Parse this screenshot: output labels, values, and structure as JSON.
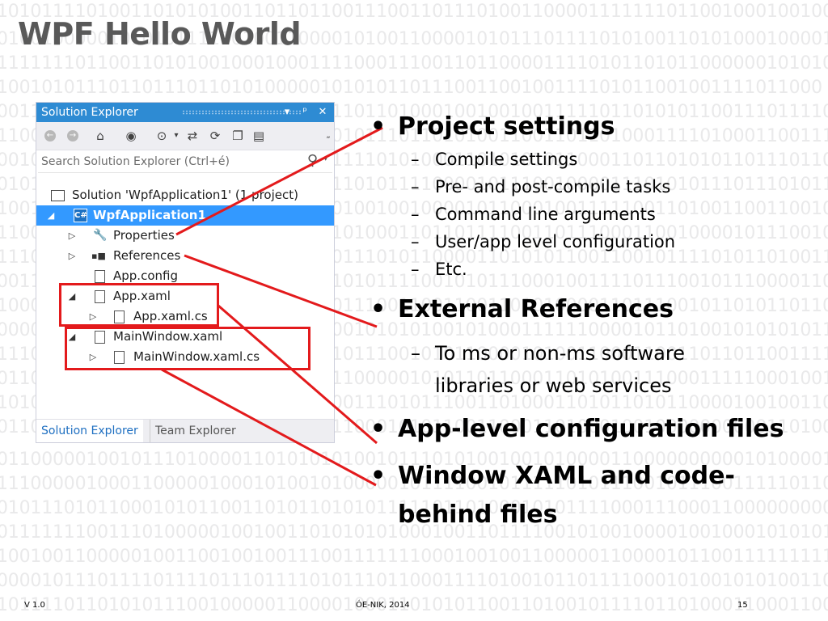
{
  "slide": {
    "title": "WPF Hello World",
    "background_digits_color": "#e9e9ea",
    "binary_rows": [
      "10101111010011010101001101101100111001101110100110000111111101100100010010001",
      "01001000001010101111101001100001010011000010101110111101010011010100010000100000010",
      "11111110110011010100100010001111000111001101100001111010110101100000010101010",
      "10010101110110111011010100000101010110111001100100111101011001001111011000",
      "00110010111011101110010010011011011010001001001001111101101010110011101111010",
      "11001010101100011011001101110001011101101010011001101101000111101000110011111",
      "00100010000111101101010101110111110101000110101010110001101101010110111011010",
      "01011001100001011101000110000111010111100001011100100001110101011101110101110",
      "10010011001110111110000000101001001001000010110001001111100110100110011001000",
      "11000001001101001011100111001110100011011011110011011100011001000010111001001",
      "11100110000110001111100101110001110101100001101010110011001011110101101001101",
      "00110000110010111001001110101010101111001010111000100111101110010111000011011",
      "10000100101100101110011100011101110011001100110101000011011100101101011011010",
      "00000000100101111100101101001100101010100101000111111000010110100101010101100",
      "11101011010110011101001110000110111001010110000101001100011001101101100111101",
      "01100101110101100000100001101011000001010110110001101010011100011111000100110",
      "10101110010101000011010001111000111010111001101000110101101011000010010011011",
      "01100001100011000101010101000011000101011001100011010001001000000000011010001111",
      "01100000100101110100001101010101001011101010010010100001100000000001010000101011",
      "11100000100011000001000101001010000010111100101111101011100101110011111011001",
      "01011101011000101011001101011010101111101101000101011110001110001100000000000",
      "01111111001110100000100100110101010100010011011110010100100001001000101010110110",
      "10010011000001001100100100111001111111000100100110000011000010110011111111100",
      "00001011101111011110111011110101110110001111010010110111100010100101010011001100",
      "10111101101010111001000001100001000110101011001101001011110110100011000110001"
    ]
  },
  "solution_explorer": {
    "title": "Solution Explorer",
    "titlebar_buttons": [
      "▾",
      "ᵖ",
      "✕"
    ],
    "toolbar_icons": [
      "back-icon",
      "forward-icon",
      "home-icon",
      "solutions-view-icon",
      "pending-changes-icon",
      "sync-icon",
      "refresh-icon",
      "collapse-all-icon",
      "properties-icon"
    ],
    "search_placeholder": "Search Solution Explorer (Ctrl+é)",
    "tree": [
      {
        "label": "Solution 'WpfApplication1' (1 project)",
        "arrow": "",
        "icon": "solution-icon",
        "selected": false
      },
      {
        "label": "WpfApplication1",
        "arrow": "◢",
        "icon": "csharp-project-icon",
        "icon_text": "C#",
        "selected": true
      },
      {
        "label": "Properties",
        "arrow": "▷",
        "icon": "wrench-icon",
        "selected": false
      },
      {
        "label": "References",
        "arrow": "▷",
        "icon": "references-icon",
        "selected": false
      },
      {
        "label": "App.config",
        "arrow": "",
        "icon": "config-file-icon",
        "selected": false
      },
      {
        "label": "App.xaml",
        "arrow": "◢",
        "icon": "xaml-file-icon",
        "selected": false
      },
      {
        "label": "App.xaml.cs",
        "arrow": "▷",
        "icon": "csharp-file-icon",
        "selected": false
      },
      {
        "label": "MainWindow.xaml",
        "arrow": "◢",
        "icon": "xaml-file-icon",
        "selected": false
      },
      {
        "label": "MainWindow.xaml.cs",
        "arrow": "▷",
        "icon": "csharp-file-icon",
        "selected": false
      }
    ],
    "bottom_tabs": [
      "Solution Explorer",
      "Team Explorer"
    ]
  },
  "bullets": [
    {
      "text": "Project settings",
      "subs": [
        "Compile settings",
        "Pre- and post-compile tasks",
        "Command line arguments",
        "User/app level configuration",
        "Etc."
      ]
    },
    {
      "text": "External References",
      "subs": [
        "To ms or non-ms software",
        "libraries or web services"
      ]
    },
    {
      "text": "App-level configuration files",
      "subs": []
    },
    {
      "text": "Window XAML and code-",
      "subs": []
    },
    {
      "text": "behind files",
      "subs": []
    }
  ],
  "bullet_marker": "•",
  "sub_marker": "–",
  "footer": {
    "version": "V 1.0",
    "center": "ÓE-NIK, 2014",
    "page": "15"
  },
  "highlight_color": "#e31a1c",
  "selection_color": "#3399ff",
  "titlebar_color": "#2e8bd3"
}
